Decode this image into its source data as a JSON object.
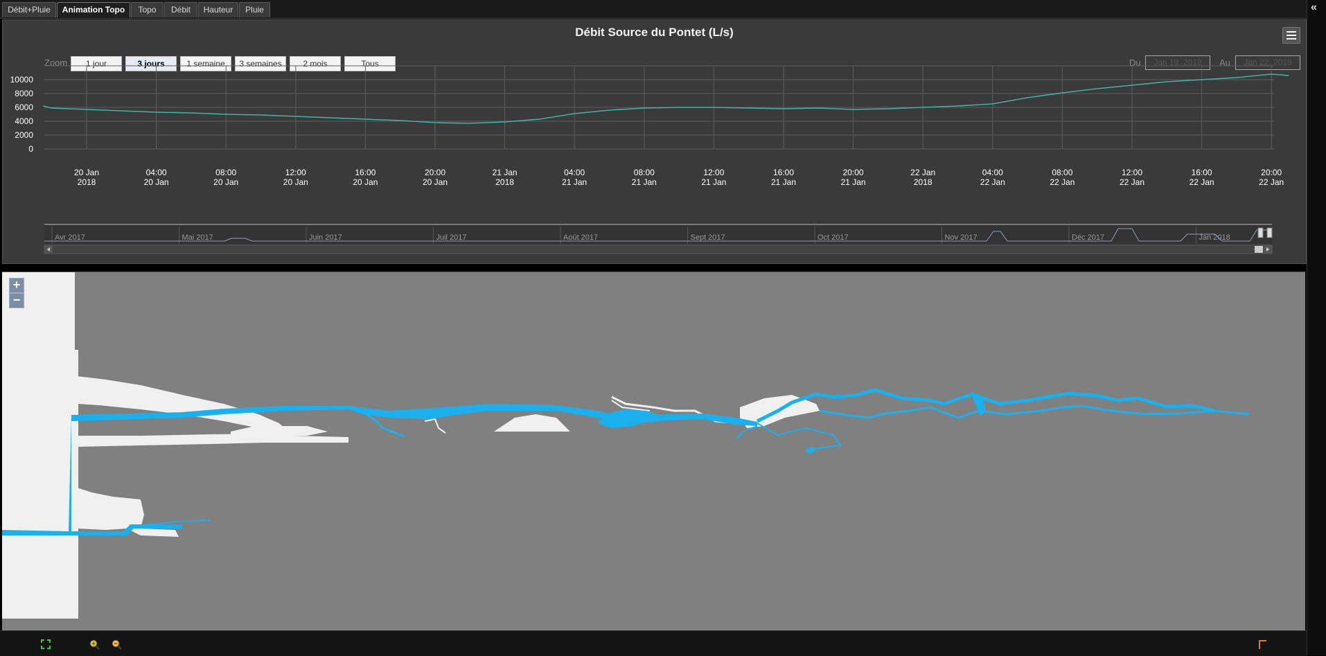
{
  "tabs": [
    {
      "label": "Débit+Pluie",
      "active": false
    },
    {
      "label": "Animation Topo",
      "active": true
    },
    {
      "label": "Topo",
      "active": false
    },
    {
      "label": "Débit",
      "active": false
    },
    {
      "label": "Hauteur",
      "active": false
    },
    {
      "label": "Pluie",
      "active": false
    }
  ],
  "collapse_glyph": "«",
  "chart": {
    "title": "Débit Source du Pontet (L/s)",
    "zoom_label": "Zoom",
    "zoom_buttons": [
      "1 jour",
      "3 jours",
      "1 semaine",
      "3 semaines",
      "2 mois",
      "Tous"
    ],
    "zoom_selected": "3 jours",
    "from_label": "Du",
    "from_value": "Jan 19, 2018",
    "to_label": "Au",
    "to_value": "Jan 22, 2018"
  },
  "navigator": {
    "months": [
      "Avr 2017",
      "Mai 2017",
      "Juin 2017",
      "Juil 2017",
      "Août 2017",
      "Sept 2017",
      "Oct 2017",
      "Nov 2017",
      "Déc 2017",
      "Jan 2018"
    ]
  },
  "chart_data": {
    "type": "line",
    "title": "Débit Source du Pontet (L/s)",
    "ylabel": "",
    "xlabel": "",
    "ylim": [
      0,
      10000
    ],
    "y_ticks": [
      "0",
      "2000",
      "4000",
      "6000",
      "8000",
      "10000"
    ],
    "x_ticks": [
      [
        "20 Jan",
        "2018"
      ],
      [
        "04:00",
        "20 Jan"
      ],
      [
        "08:00",
        "20 Jan"
      ],
      [
        "12:00",
        "20 Jan"
      ],
      [
        "16:00",
        "20 Jan"
      ],
      [
        "20:00",
        "20 Jan"
      ],
      [
        "21 Jan",
        "2018"
      ],
      [
        "04:00",
        "21 Jan"
      ],
      [
        "08:00",
        "21 Jan"
      ],
      [
        "12:00",
        "21 Jan"
      ],
      [
        "16:00",
        "21 Jan"
      ],
      [
        "20:00",
        "21 Jan"
      ],
      [
        "22 Jan",
        "2018"
      ],
      [
        "04:00",
        "22 Jan"
      ],
      [
        "08:00",
        "22 Jan"
      ],
      [
        "12:00",
        "22 Jan"
      ],
      [
        "16:00",
        "22 Jan"
      ],
      [
        "20:00",
        "22 Jan"
      ]
    ],
    "grid": true,
    "series": [
      {
        "color": "#3fb3a5",
        "x_hours": [
          -2.5,
          -2,
          0,
          2,
          4,
          6,
          8,
          10,
          12,
          14,
          16,
          18,
          20,
          22,
          24,
          26,
          28,
          30,
          32,
          34,
          36,
          38,
          40,
          42,
          44,
          46,
          48,
          50,
          52,
          54,
          56,
          58,
          60,
          62,
          64,
          66,
          68,
          69
        ],
        "values": [
          6200,
          5900,
          5700,
          5500,
          5300,
          5200,
          5000,
          4900,
          4700,
          4500,
          4300,
          4100,
          3800,
          3700,
          3900,
          4300,
          5100,
          5600,
          5900,
          6000,
          6000,
          5900,
          5800,
          5900,
          5700,
          5800,
          6000,
          6200,
          6500,
          7400,
          8100,
          8700,
          9200,
          9700,
          10000,
          10300,
          10800,
          10600
        ]
      }
    ]
  },
  "map": {
    "zoom_in": "+",
    "zoom_out": "−",
    "colors": {
      "background": "#808080",
      "passage": "#f0f0f0",
      "water": "#1ab0ee"
    }
  },
  "bottom_icons": [
    "fullscreen-icon",
    "zoom-in-icon",
    "zoom-out-icon",
    "flag-icon"
  ]
}
